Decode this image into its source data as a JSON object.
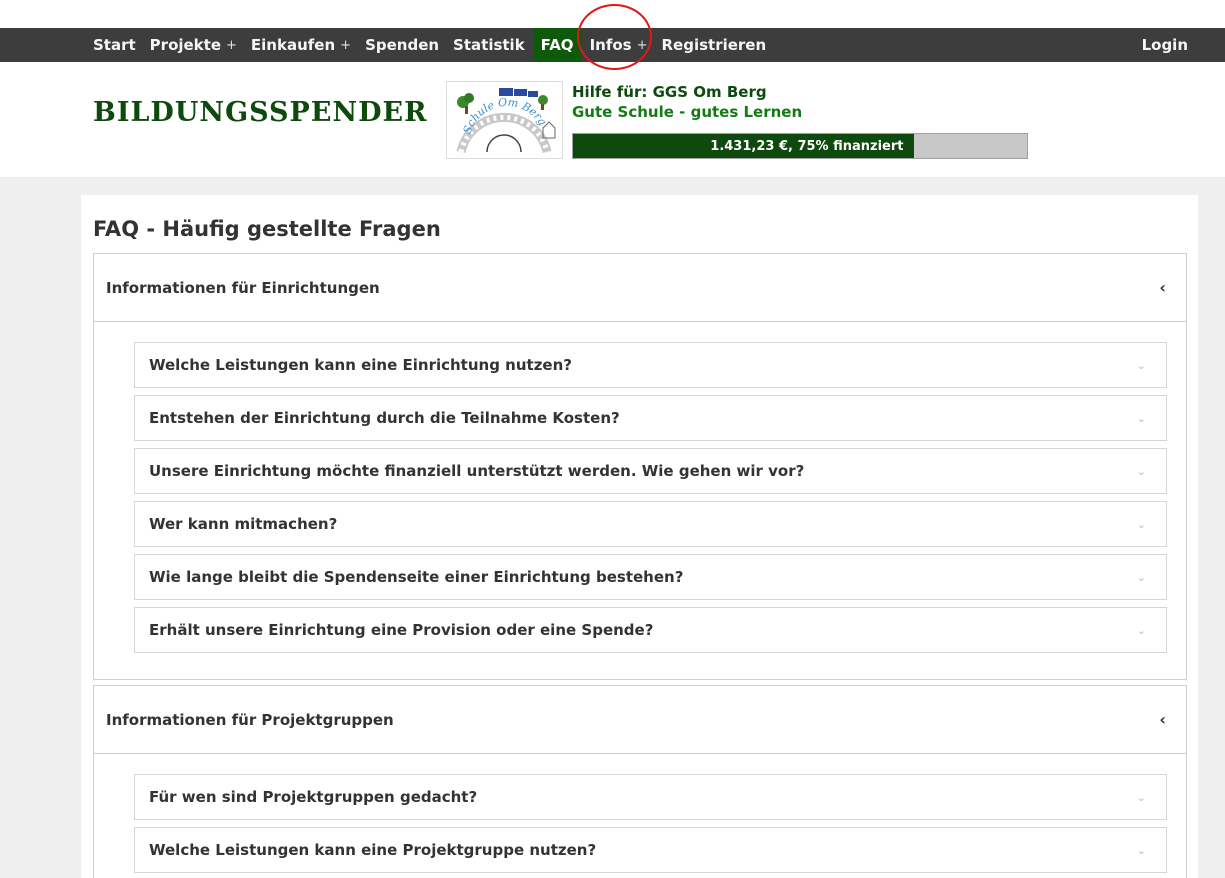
{
  "nav": {
    "items": [
      {
        "label": "Start",
        "plus": ""
      },
      {
        "label": "Projekte",
        "plus": "+"
      },
      {
        "label": "Einkaufen",
        "plus": "+"
      },
      {
        "label": "Spenden",
        "plus": ""
      },
      {
        "label": "Statistik",
        "plus": ""
      },
      {
        "label": "FAQ",
        "plus": ""
      },
      {
        "label": "Infos",
        "plus": "+"
      },
      {
        "label": "Registrieren",
        "plus": ""
      }
    ],
    "active": "FAQ",
    "login": "Login",
    "active_color": "#0e5a0a",
    "bar_color": "#3d3d3d"
  },
  "header": {
    "brand": "BILDUNGSSPENDER",
    "logo_text": "Schule Om Berg",
    "help_title": "Hilfe für: GGS Om Berg",
    "help_subtitle": "Gute Schule - gutes Lernen",
    "progress_label": "1.431,23 €, 75% finanziert",
    "progress_percent": 75,
    "brand_color": "#0e4a0e"
  },
  "faq": {
    "title": "FAQ - Häufig gestellte Fragen",
    "sections": [
      {
        "title": "Informationen für Einrichtungen",
        "questions": [
          "Welche Leistungen kann eine Einrichtung nutzen?",
          "Entstehen der Einrichtung durch die Teilnahme Kosten?",
          "Unsere Einrichtung möchte finanziell unterstützt werden. Wie gehen wir vor?",
          "Wer kann mitmachen?",
          "Wie lange bleibt die Spendenseite einer Einrichtung bestehen?",
          "Erhält unsere Einrichtung eine Provision oder eine Spende?"
        ]
      },
      {
        "title": "Informationen für Projektgruppen",
        "questions": [
          "Für wen sind Projektgruppen gedacht?",
          "Welche Leistungen kann eine Projektgruppe nutzen?"
        ]
      }
    ],
    "section_chevron": "‹",
    "question_chevron": "⌄"
  }
}
